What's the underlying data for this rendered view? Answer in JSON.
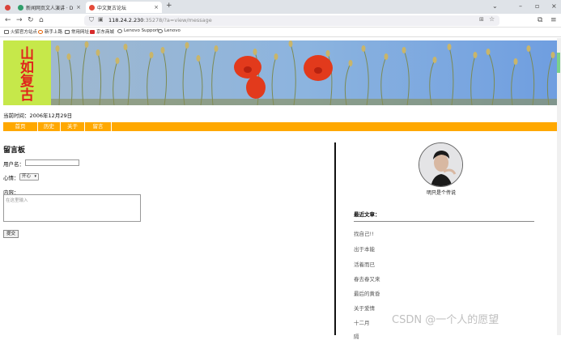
{
  "browser": {
    "tabs": [
      {
        "title": "新闻网页文人演讲 · D:\\toc:\\CH",
        "color": "#2f9e6a"
      },
      {
        "title": "中文复古论坛",
        "color": "#e44b3a"
      }
    ],
    "new_tab": "+",
    "url_host": "118.24.2.230",
    "url_rest": ":35278/?a=view/message",
    "bookmarks": [
      "火狐官方站点",
      "新手上路",
      "常用网址",
      "京东商城",
      "Lenovo Support",
      "Lenovo"
    ]
  },
  "site": {
    "logo_chars": [
      "山",
      "如",
      "复",
      "古"
    ],
    "time_label": "当前时间：",
    "time_value": "2006年12月29日",
    "menu": [
      "首页",
      "历史",
      "关于",
      "留言"
    ]
  },
  "board": {
    "title": "留言板",
    "username_label": "用户名：",
    "mood_label": "心情：",
    "mood_value": "开心",
    "content_label": "内容：",
    "content_placeholder": "在这里输入",
    "submit_label": "提交"
  },
  "sidebar": {
    "author_name": "明只是个传说",
    "recent_title": "最近文章：",
    "articles": [
      "找自己!!",
      "出于本能",
      "活着而已",
      "春去春又来",
      "最后的黄昏",
      "关于爱情",
      "十二月",
      "隔"
    ]
  },
  "watermark": "CSDN @一个人的愿望",
  "colors": {
    "menu_bar": "#ffa800",
    "logo_bg": "#c6e84a",
    "logo_text": "#e0241c"
  }
}
